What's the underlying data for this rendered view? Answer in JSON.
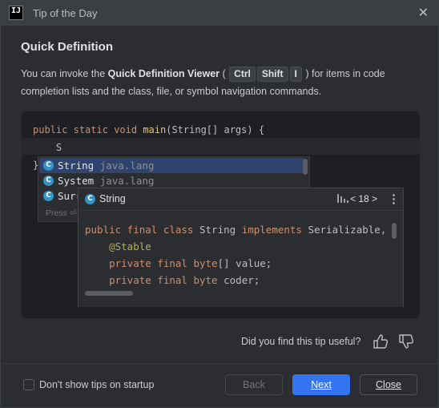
{
  "window": {
    "app_icon_text": "IJ",
    "title": "Tip of the Day",
    "close_icon": "close-icon"
  },
  "tip": {
    "heading": "Quick Definition",
    "desc_prefix": "You can invoke the ",
    "feature_name": "Quick Definition Viewer",
    "paren_open": " (",
    "keys": [
      "Ctrl",
      "Shift",
      "I"
    ],
    "paren_close": " )",
    "desc_suffix": " for items in code completion lists and the class, file, or symbol navigation commands."
  },
  "editor": {
    "line1": {
      "kw1": "public",
      "kw2": "static",
      "kw3": "void",
      "fn": "main",
      "rest": "(String[] args) {"
    },
    "line2": "S",
    "line3": "}",
    "completion": {
      "items": [
        {
          "name": "String",
          "pkg": "java.lang",
          "selected": true
        },
        {
          "name": "System",
          "pkg": "java.lang",
          "selected": false
        },
        {
          "name": "Surr",
          "pkg": "",
          "selected": false
        }
      ],
      "press_hint": "Press ⏎"
    },
    "definition": {
      "title": "String",
      "counter": "< 18 >",
      "code": {
        "l1_kw": "public final class",
        "l1_cls": "String",
        "l1_kw2": "implements",
        "l1_rest": "Serializable,",
        "l2": "@Stable",
        "l3_kw": "private final",
        "l3_type": "byte",
        "l3_rest": "[] value;",
        "l4_kw": "private final",
        "l4_type": "byte",
        "l4_rest": "coder;"
      }
    }
  },
  "feedback": {
    "question": "Did you find this tip useful?"
  },
  "footer": {
    "checkbox_label": "Don't show tips on startup",
    "checkbox_checked": false,
    "back_label": "Back",
    "next_label": "Next",
    "close_label": "Close"
  },
  "colors": {
    "accent": "#3574f0",
    "background": "#2b2d30",
    "editor_bg": "#1e1f22",
    "keyword": "#cf8e6d",
    "selection": "#2e436e"
  }
}
